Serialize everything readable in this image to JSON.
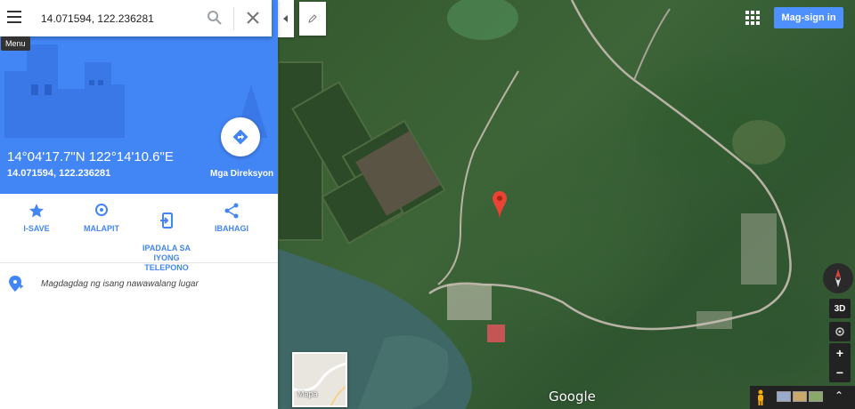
{
  "search": {
    "value": "14.071594, 122.236281",
    "menu_tooltip": "Menu"
  },
  "place": {
    "title": "14°04'17.7\"N 122°14'10.6\"E",
    "subtitle": "14.071594, 122.236281",
    "directions_label": "Mga Direksyon"
  },
  "actions": [
    {
      "label": "I-SAVE",
      "icon": "star-icon"
    },
    {
      "label": "MALAPIT",
      "icon": "nearby-icon"
    },
    {
      "label": "IPADALA SA\nIYONG\nTELEPONO",
      "icon": "send-to-phone-icon"
    },
    {
      "label": "IBAHAGI",
      "icon": "share-icon"
    }
  ],
  "add_place": {
    "label": "Magdagdag ng isang nawawalang lugar"
  },
  "map": {
    "signin_label": "Mag-sign in",
    "btn_3d": "3D",
    "zoom_in": "+",
    "zoom_out": "−",
    "minimap_label": "Mapa",
    "logo": "Google"
  },
  "colors": {
    "accent": "#4285f4",
    "pin": "#ea4335"
  }
}
